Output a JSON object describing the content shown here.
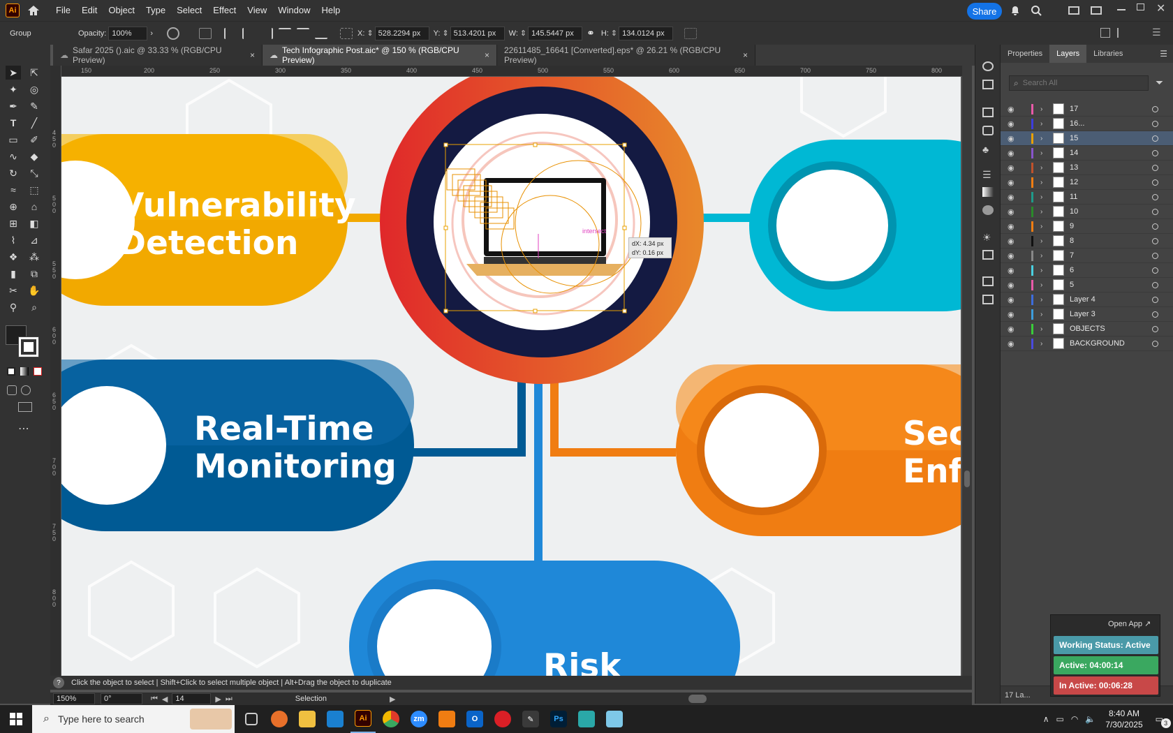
{
  "menubar": {
    "items": [
      "File",
      "Edit",
      "Object",
      "Type",
      "Select",
      "Effect",
      "View",
      "Window",
      "Help"
    ],
    "share_label": "Share",
    "app_logo": "Ai"
  },
  "control": {
    "selection_type": "Group",
    "opacity_label": "Opacity:",
    "opacity_value": "100%",
    "x_label": "X:",
    "x_value": "528.2294 px",
    "y_label": "Y:",
    "y_value": "513.4201 px",
    "w_label": "W:",
    "w_value": "145.5447 px",
    "h_label": "H:",
    "h_value": "134.0124 px"
  },
  "tabs": [
    {
      "label": "Safar 2025 ().aic @ 33.33 % (RGB/CPU Preview)",
      "active": false
    },
    {
      "label": "Tech Infographic Post.aic* @ 150 % (RGB/CPU Preview)",
      "active": true
    },
    {
      "label": "22611485_16641 [Converted].eps* @ 26.21 % (RGB/CPU Preview)",
      "active": false
    }
  ],
  "ruler": {
    "h_ticks": [
      "150",
      "200",
      "250",
      "300",
      "350",
      "400",
      "450",
      "500",
      "550",
      "600",
      "650",
      "700",
      "750",
      "800"
    ],
    "v_ticks": [
      "4\n5\n0",
      "5\n0\n0",
      "5\n5\n0",
      "6\n0\n0",
      "6\n5\n0",
      "7\n0\n0",
      "7\n5\n0",
      "8\n0\n0"
    ]
  },
  "artwork": {
    "card1_line1": "Vulnerability",
    "card1_line2": "Detection",
    "card2_line1": "Real-Time",
    "card2_line2": "Monitoring",
    "card3_line1": "Sec",
    "card3_line2": "Enf",
    "card4_line1": "Risk",
    "smart_guide": "intersect",
    "dx": "dX: 4.34 px",
    "dy": "dY: 0.16 px",
    "colors": {
      "yellow": "#f2a900",
      "blue": "#005a94",
      "orange": "#f07d12",
      "teal": "#00a9c8",
      "red": "#e03a2a",
      "navy": "#141a42",
      "light_blue": "#1f88d8"
    }
  },
  "status": {
    "hint": "Click the object to select  |  Shift+Click to select multiple object  |  Alt+Drag the object to duplicate",
    "zoom": "150%",
    "rotation": "0°",
    "artboard": "14",
    "tool": "Selection"
  },
  "panel": {
    "tabs": [
      "Properties",
      "Layers",
      "Libraries"
    ],
    "active_tab": "Layers",
    "search_placeholder": "Search All",
    "layers": [
      {
        "name": "17",
        "color": "#e85aa8",
        "sel": false
      },
      {
        "name": "16...",
        "color": "#3d3ddc",
        "sel": false
      },
      {
        "name": "15",
        "color": "#e8a000",
        "sel": true
      },
      {
        "name": "14",
        "color": "#8855cc",
        "sel": false
      },
      {
        "name": "13",
        "color": "#c0522b",
        "sel": false
      },
      {
        "name": "12",
        "color": "#f07d12",
        "sel": false
      },
      {
        "name": "11",
        "color": "#1f9a8a",
        "sel": false
      },
      {
        "name": "10",
        "color": "#2a8a2a",
        "sel": false
      },
      {
        "name": "9",
        "color": "#f07d12",
        "sel": false
      },
      {
        "name": "8",
        "color": "#111111",
        "sel": false
      },
      {
        "name": "7",
        "color": "#888888",
        "sel": false
      },
      {
        "name": "6",
        "color": "#4ad0e0",
        "sel": false
      },
      {
        "name": "5",
        "color": "#e85aa8",
        "sel": false
      },
      {
        "name": "Layer 4",
        "color": "#3d6ddc",
        "sel": false
      },
      {
        "name": "Layer 3",
        "color": "#3d9ddc",
        "sel": false
      },
      {
        "name": "OBJECTS",
        "color": "#3acc3a",
        "sel": false
      },
      {
        "name": "BACKGROUND",
        "color": "#4a4add",
        "sel": false
      }
    ],
    "footer_count": "17 La..."
  },
  "widget": {
    "open_app": "Open App ↗",
    "working": "Working Status: Active",
    "active": "Active: 04:00:14",
    "inactive": "In Active: 00:06:28"
  },
  "taskbar": {
    "search_placeholder": "Type here to search",
    "time": "8:40 AM",
    "date": "7/30/2025",
    "notification_count": "3"
  }
}
